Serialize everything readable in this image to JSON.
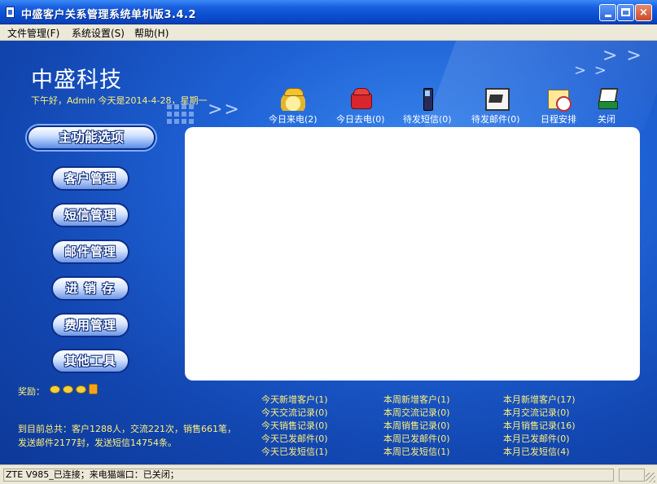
{
  "window": {
    "title": "中盛客户关系管理系统单机版3.4.2",
    "minimize_icon": "minimize-icon",
    "maximize_icon": "maximize-icon",
    "close_label": "×"
  },
  "menubar": {
    "items": [
      "文件管理(F)",
      "系统设置(S)",
      "帮助(H)"
    ]
  },
  "header": {
    "company": "中盛科技",
    "greeting": "下午好，Admin  今天是2014-4-28，星期一"
  },
  "toolbar": [
    {
      "label": "今日来电(2)",
      "icon": "incoming-call-icon"
    },
    {
      "label": "今日去电(0)",
      "icon": "outgoing-call-icon"
    },
    {
      "label": "待发短信(0)",
      "icon": "mobile-sms-icon"
    },
    {
      "label": "待发邮件(0)",
      "icon": "mail-icon"
    },
    {
      "label": "日程安排",
      "icon": "calendar-clock-icon"
    },
    {
      "label": "关闭",
      "icon": "exit-icon"
    }
  ],
  "nav": {
    "title": "主功能选项",
    "items": [
      "客户管理",
      "短信管理",
      "邮件管理",
      "进 销 存",
      "费用管理",
      "其他工具"
    ]
  },
  "reward": {
    "label": "奖励：",
    "icons": [
      "coin-icon",
      "coin-icon",
      "coin-icon",
      "money-bag-icon"
    ]
  },
  "summary": {
    "line1": "到目前总共：客户1288人，交流221次，销售661笔，",
    "line2": "发送邮件2177封，发送短信14754条。"
  },
  "stats": {
    "today": [
      "今天新增客户(1)",
      "今天交流记录(0)",
      "今天销售记录(0)",
      "今天已发邮件(0)",
      "今天已发短信(1)"
    ],
    "week": [
      "本周新增客户(1)",
      "本周交流记录(0)",
      "本周销售记录(0)",
      "本周已发邮件(0)",
      "本周已发短信(1)"
    ],
    "month": [
      "本月新增客户(17)",
      "本月交流记录(0)",
      "本月销售记录(16)",
      "本月已发邮件(0)",
      "本月已发短信(4)"
    ]
  },
  "statusbar": {
    "text": "ZTE V985_已连接；来电猫端口：已关闭；"
  }
}
